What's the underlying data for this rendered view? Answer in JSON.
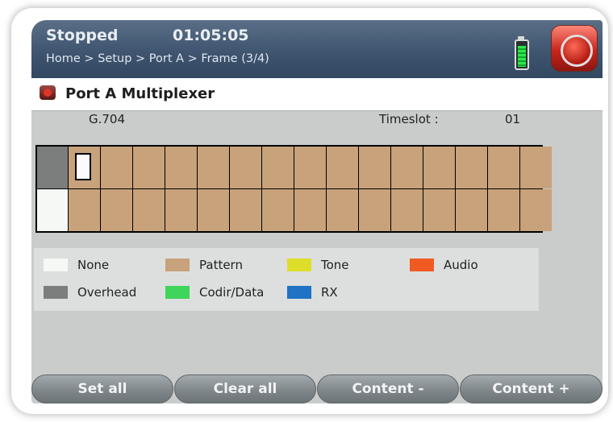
{
  "header": {
    "state": "Stopped",
    "time": "01:05:05",
    "breadcrumb": "Home > Setup > Port A > Frame (3/4)",
    "battery_level": 1.0
  },
  "page": {
    "title": "Port A Multiplexer"
  },
  "frame_info": {
    "standard": "G.704",
    "timeslot_label": "Timeslot :",
    "timeslot_value": "01"
  },
  "timeslot_grid": {
    "rows": 2,
    "cols": 16,
    "row1": [
      "Overhead",
      "Pattern",
      "Pattern",
      "Pattern",
      "Pattern",
      "Pattern",
      "Pattern",
      "Pattern",
      "Pattern",
      "Pattern",
      "Pattern",
      "Pattern",
      "Pattern",
      "Pattern",
      "Pattern",
      "Pattern"
    ],
    "row2": [
      "None",
      "Pattern",
      "Pattern",
      "Pattern",
      "Pattern",
      "Pattern",
      "Pattern",
      "Pattern",
      "Pattern",
      "Pattern",
      "Pattern",
      "Pattern",
      "Pattern",
      "Pattern",
      "Pattern",
      "Pattern"
    ],
    "selected_timeslot": "01"
  },
  "legend": [
    {
      "label": "None",
      "color": "#f5f8f5"
    },
    {
      "label": "Pattern",
      "color": "#c8a27a"
    },
    {
      "label": "Tone",
      "color": "#dede2a"
    },
    {
      "label": "Audio",
      "color": "#f05a22"
    },
    {
      "label": "Overhead",
      "color": "#7c7d7d"
    },
    {
      "label": "Codir/Data",
      "color": "#3fd45a"
    },
    {
      "label": "RX",
      "color": "#1f72c4"
    }
  ],
  "softkeys": {
    "set_all": "Set all",
    "clear_all": "Clear all",
    "content_minus": "Content -",
    "content_plus": "Content +"
  }
}
